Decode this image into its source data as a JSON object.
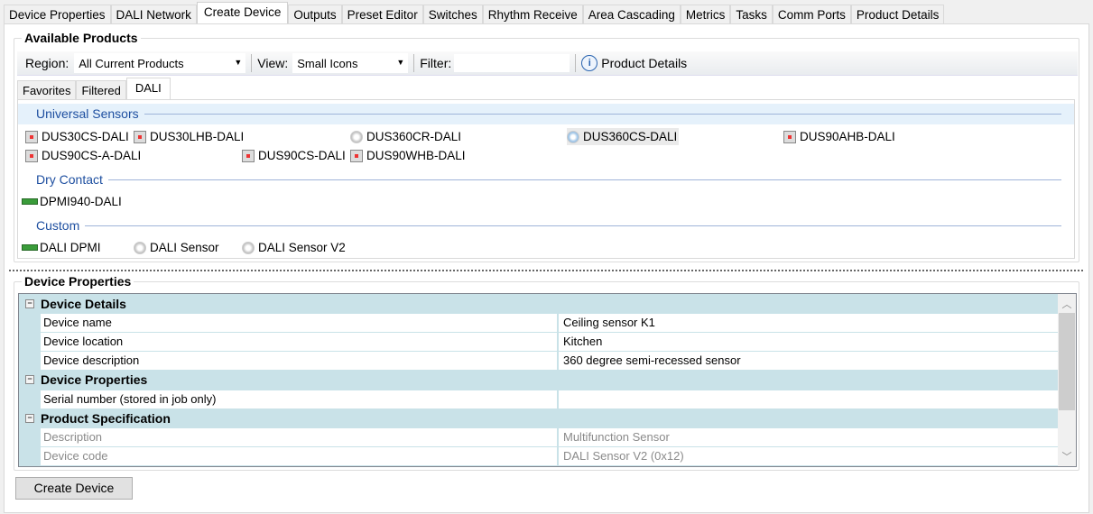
{
  "tabs": [
    "Device Properties",
    "DALI Network",
    "Create Device",
    "Outputs",
    "Preset Editor",
    "Switches",
    "Rhythm Receive",
    "Area Cascading",
    "Metrics",
    "Tasks",
    "Comm Ports",
    "Product Details"
  ],
  "active_tab": "Create Device",
  "available_products": {
    "title": "Available Products",
    "region_label": "Region:",
    "region_value": "All Current Products",
    "view_label": "View:",
    "view_value": "Small Icons",
    "filter_label": "Filter:",
    "filter_value": "",
    "product_details_label": "Product Details",
    "inner_tabs": [
      "Favorites",
      "Filtered",
      "DALI"
    ],
    "active_inner_tab": "DALI",
    "categories": [
      {
        "name": "Universal Sensors",
        "items": [
          {
            "label": "DUS30CS-DALI",
            "icon": "box"
          },
          {
            "label": "DUS30LHB-DALI",
            "icon": "box"
          },
          {
            "label": "DUS360CR-DALI",
            "icon": "round"
          },
          {
            "label": "DUS360CS-DALI",
            "icon": "round",
            "selected": true
          },
          {
            "label": "DUS90AHB-DALI",
            "icon": "box"
          },
          {
            "label": "DUS90CS-A-DALI",
            "icon": "box"
          },
          {
            "label": "DUS90CS-DALI",
            "icon": "box"
          },
          {
            "label": "DUS90WHB-DALI",
            "icon": "box"
          }
        ]
      },
      {
        "name": "Dry Contact",
        "items": [
          {
            "label": "DPMI940-DALI",
            "icon": "green"
          }
        ]
      },
      {
        "name": "Custom",
        "items": [
          {
            "label": "DALI DPMI",
            "icon": "green"
          },
          {
            "label": "DALI Sensor",
            "icon": "round"
          },
          {
            "label": "DALI Sensor V2",
            "icon": "round"
          }
        ]
      }
    ]
  },
  "device_properties": {
    "title": "Device Properties",
    "rows": [
      {
        "type": "head",
        "name": "Device Details"
      },
      {
        "type": "prop",
        "name": "Device name",
        "value": "Ceiling sensor K1"
      },
      {
        "type": "prop",
        "name": "Device location",
        "value": "Kitchen"
      },
      {
        "type": "prop",
        "name": "Device description",
        "value": "360 degree semi-recessed sensor"
      },
      {
        "type": "head",
        "name": "Device Properties"
      },
      {
        "type": "prop",
        "name": "Serial number (stored in job only)",
        "value": ""
      },
      {
        "type": "head",
        "name": "Product Specification"
      },
      {
        "type": "ro",
        "name": "Description",
        "value": "Multifunction Sensor"
      },
      {
        "type": "ro",
        "name": "Device code",
        "value": "DALI Sensor V2 (0x12)"
      }
    ]
  },
  "create_button": "Create Device"
}
